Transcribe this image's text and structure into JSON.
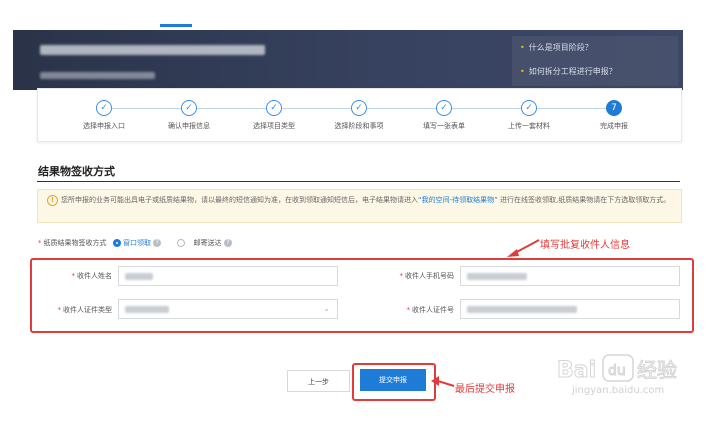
{
  "header": {
    "links": [
      "什么是项目阶段？",
      "如何拆分工程进行申报？"
    ]
  },
  "steps": [
    {
      "label": "选择申报入口",
      "mark": "✓"
    },
    {
      "label": "确认申报信息",
      "mark": "✓"
    },
    {
      "label": "选择项目类型",
      "mark": "✓"
    },
    {
      "label": "选择阶段和事项",
      "mark": "✓"
    },
    {
      "label": "填写一张表单",
      "mark": "✓"
    },
    {
      "label": "上传一套材料",
      "mark": "✓"
    },
    {
      "label": "完成申报",
      "mark": "7"
    }
  ],
  "section": {
    "title": "结果物签收方式"
  },
  "notice": {
    "icon": "!",
    "text_before": "您所申报的业务可能出具电子或纸质结果物，请以最终的短信通知为准，在收到领取通知短信后，电子结果物请进入",
    "link": "“我的空间-待领取结果物”",
    "text_after": "进行在线签收领取,纸质结果物请在下方选取领取方式。"
  },
  "method": {
    "label": "纸质结果物签收方式",
    "options": [
      {
        "label": "窗口领取",
        "selected": true
      },
      {
        "label": "邮寄送达",
        "selected": false
      }
    ]
  },
  "form": {
    "name_label": "收件人姓名",
    "phone_label": "收件人手机号码",
    "idtype_label": "收件人证件类型",
    "idno_label": "收件人证件号"
  },
  "annotations": {
    "fill_info": "填写批复收件人信息",
    "submit_hint": "最后提交申报"
  },
  "buttons": {
    "prev": "上一步",
    "submit": "提交申报"
  },
  "watermark": {
    "brand": "Bai du 经验",
    "url": "jingyan.baidu.com"
  },
  "colors": {
    "accent": "#1e7bd6",
    "annotation": "#e23b3b",
    "notice_bg": "#fdf7e6"
  }
}
